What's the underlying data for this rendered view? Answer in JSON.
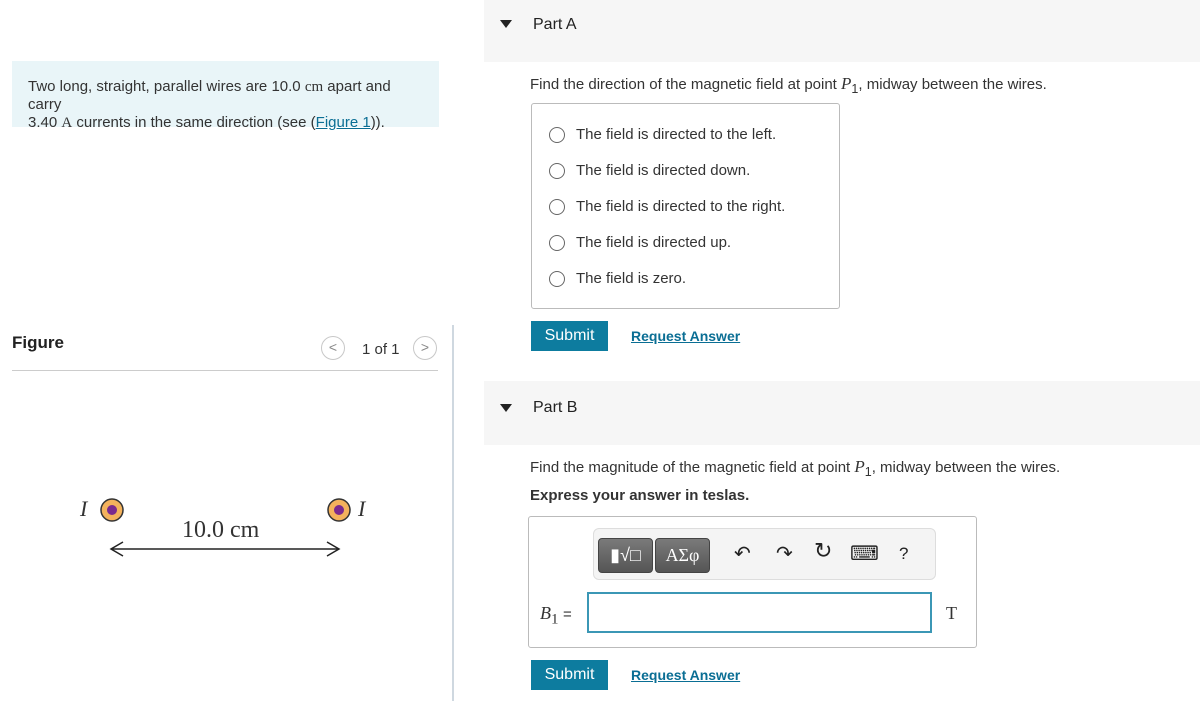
{
  "problem": {
    "text_before": "Two long, straight, parallel wires are 10.0 ",
    "unit_cm": "cm",
    "text_mid": " apart and carry",
    "current": "3.40 ",
    "unit_A": "A",
    "text_after": " currents in the same direction (see (",
    "figure_link": "Figure 1",
    "text_end": "))."
  },
  "figure": {
    "heading": "Figure",
    "counter": "1 of 1",
    "prev_icon": "<",
    "next_icon": ">",
    "label_left": "I",
    "label_right": "I",
    "distance": "10.0 cm",
    "wire_ring_color": "#f4b25c",
    "wire_dot_color": "#7b2a8e"
  },
  "partA": {
    "title": "Part A",
    "question_pre": "Find the direction of the magnetic field at point ",
    "point": "P",
    "sub": "1",
    "question_post": ", midway between the wires.",
    "options": [
      "The field is directed to the left.",
      "The field is directed down.",
      "The field is directed to the right.",
      "The field is directed up.",
      "The field is zero."
    ],
    "submit": "Submit",
    "request": "Request Answer"
  },
  "partB": {
    "title": "Part B",
    "question_pre": "Find the magnitude of the magnetic field at point ",
    "point": "P",
    "sub": "1",
    "question_post": ", midway between the wires.",
    "instruction": "Express your answer in teslas.",
    "toolbar": {
      "templates": "▮√□",
      "greek": "ΑΣφ",
      "undo": "↶",
      "redo": "↷",
      "reset": "↻",
      "keyboard": "⌨",
      "help": "?"
    },
    "var": "B",
    "var_sub": "1",
    "equals": "=",
    "input_value": "",
    "unit": "T",
    "submit": "Submit",
    "request": "Request Answer"
  },
  "colors": {
    "accent": "#0d7c9f",
    "intro_bg": "#e9f5f8"
  }
}
